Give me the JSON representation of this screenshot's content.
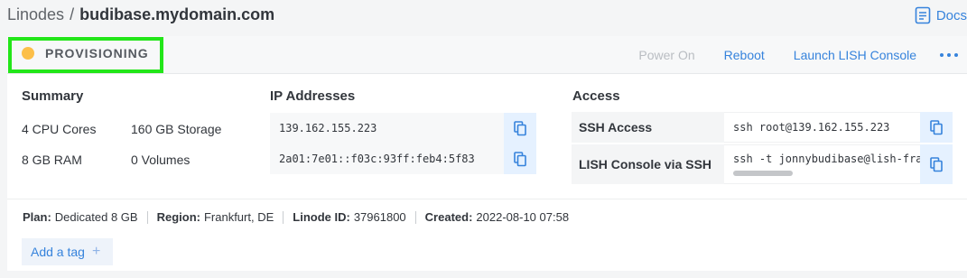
{
  "breadcrumb": {
    "parent": "Linodes",
    "separator": "/",
    "current": "budibase.mydomain.com"
  },
  "docs": {
    "label": "Docs",
    "icon": "document-icon"
  },
  "status": {
    "label": "PROVISIONING",
    "color": "#fcbf49",
    "highlight_color": "#22e619"
  },
  "actions": {
    "power_on": "Power On",
    "reboot": "Reboot",
    "launch_lish": "Launch LISH Console",
    "more_icon": "more-horizontal-icon"
  },
  "summary": {
    "title": "Summary",
    "cpu": "4 CPU Cores",
    "storage": "160 GB Storage",
    "ram": "8 GB RAM",
    "volumes": "0 Volumes"
  },
  "ip_addresses": {
    "title": "IP Addresses",
    "ipv4": "139.162.155.223",
    "ipv6": "2a01:7e01::f03c:93ff:feb4:5f83",
    "copy_icon": "copy-icon"
  },
  "access": {
    "title": "Access",
    "ssh_label": "SSH Access",
    "ssh_value": "ssh root@139.162.155.223",
    "lish_label": "LISH Console via SSH",
    "lish_value": "ssh -t jonnybudibase@lish-frankfurt.linode.com budibase"
  },
  "footer": {
    "plan_label": "Plan:",
    "plan_value": "Dedicated 8 GB",
    "region_label": "Region:",
    "region_value": "Frankfurt, DE",
    "linode_id_label": "Linode ID:",
    "linode_id_value": "37961800",
    "created_label": "Created:",
    "created_value": "2022-08-10 07:58",
    "add_tag": "Add a tag",
    "add_tag_plus": "+"
  }
}
